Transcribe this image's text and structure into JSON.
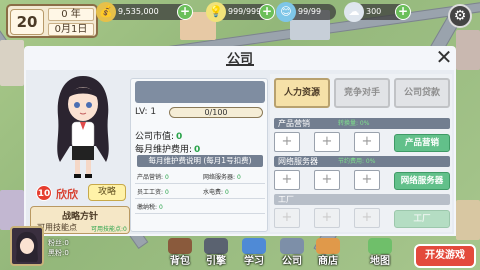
{
  "topbar": {
    "age": "20",
    "year": "0 年",
    "month_day": "0月1日",
    "resources": [
      {
        "icon": "money-bag-icon",
        "value": "9,535,000"
      },
      {
        "icon": "energy-bulb-icon",
        "value": "999/999"
      },
      {
        "icon": "mood-smile-icon",
        "value": "99/99"
      },
      {
        "icon": "cloud-icon",
        "value": "300"
      }
    ]
  },
  "dialog": {
    "title": "公司",
    "close": "✕"
  },
  "character": {
    "level": "10",
    "name": "欣欣",
    "strategy_button": "攻略",
    "policy_title": "战略方针",
    "policy_label": "可用技能点",
    "policy_count": "可用技能点:0"
  },
  "info": {
    "level_label": "LV: 1",
    "exp": "0/100",
    "market_value_label": "公司市值:",
    "market_value": "0",
    "upkeep_label": "每月维护费用:",
    "upkeep": "0",
    "note": "每月维护费说明 (每月1号扣费)",
    "small": [
      {
        "label": "产品营销:",
        "value": "0"
      },
      {
        "label": "网络服务器:",
        "value": "0"
      },
      {
        "label": "员工工资:",
        "value": "0"
      },
      {
        "label": "水电费:",
        "value": "0"
      },
      {
        "label": "缴纳税:",
        "value": "0"
      }
    ]
  },
  "right": {
    "tabs": [
      "人力资源",
      "竞争对手",
      "公司贷款"
    ],
    "sections": [
      {
        "title": "产品营销",
        "bonus": "转换量: 0%",
        "button": "产品营销"
      },
      {
        "title": "网络服务器",
        "bonus": "节约费用: 0%",
        "button": "网络服务器"
      },
      {
        "title": "工厂",
        "bonus": "",
        "button": "工厂"
      }
    ],
    "plus": "+"
  },
  "bottom": {
    "fans": "粉丝:0",
    "black_fans": "黑粉:0",
    "nav": [
      "背包",
      "引擎",
      "学习",
      "公司",
      "商店",
      "地图"
    ],
    "develop": "开发游戏"
  },
  "colors": {
    "accent_green": "#2aa34a",
    "button_green": "#62c08a",
    "develop_red": "#e34a3c",
    "header_slate": "#727e90"
  }
}
